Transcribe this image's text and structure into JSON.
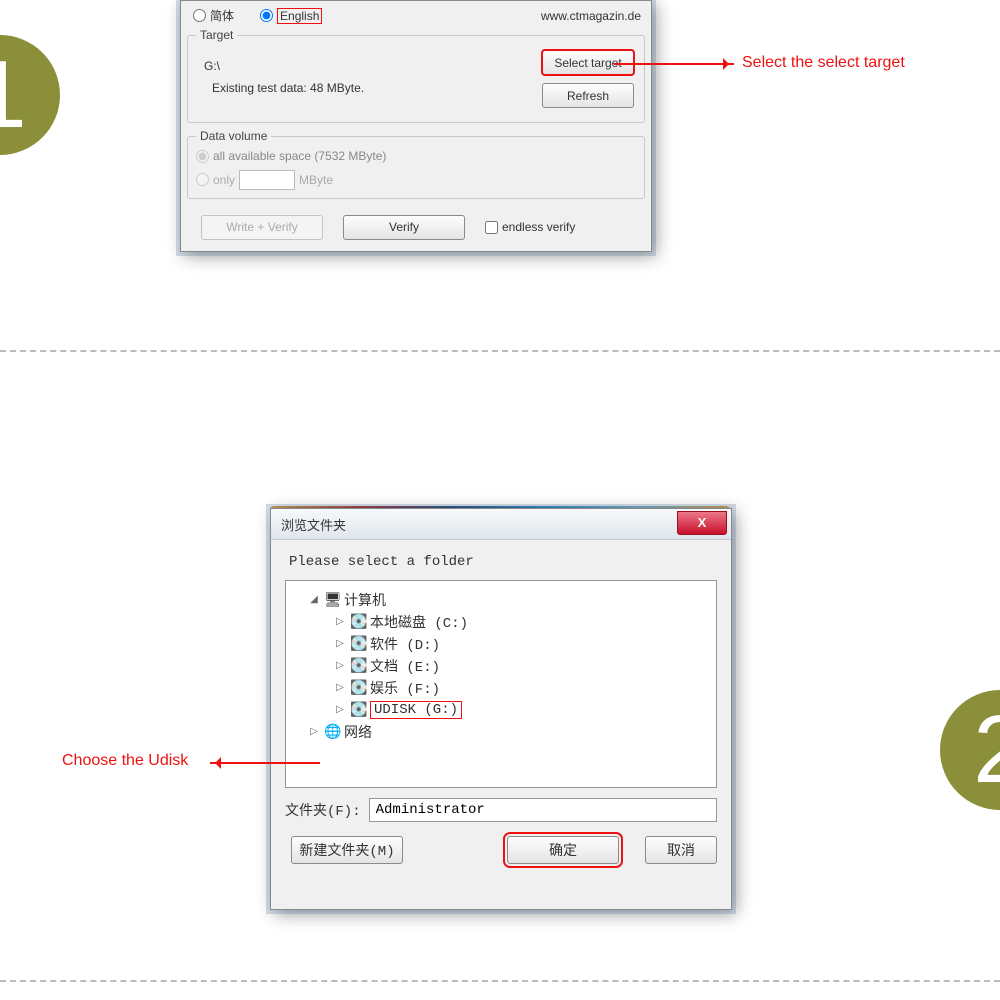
{
  "step1": {
    "badge": "1"
  },
  "step2": {
    "badge": "2"
  },
  "annot1": "Select the select target",
  "annot2": "Choose the Udisk",
  "dlg1": {
    "lang": {
      "cn": "简体",
      "en": "English"
    },
    "site": "www.ctmagazin.de",
    "target": {
      "legend": "Target",
      "drive": "G:\\",
      "existing": "Existing test data: 48 MByte.",
      "select_btn": "Select target",
      "refresh_btn": "Refresh"
    },
    "dv": {
      "legend": "Data volume",
      "opt_all": "all available space (7532 MByte)",
      "opt_only": "only",
      "unit": "MByte"
    },
    "footer": {
      "write_verify": "Write + Verify",
      "verify": "Verify",
      "endless": "endless verify"
    }
  },
  "dlg2": {
    "title": "浏览文件夹",
    "close": "X",
    "prompt": "Please select a folder",
    "tree": {
      "root": "计算机",
      "c": "本地磁盘 (C:)",
      "d": "软件 (D:)",
      "e": "文档 (E:)",
      "f": "娱乐 (F:)",
      "g": "UDISK (G:)",
      "net": "网络"
    },
    "folder_label": "文件夹(F):",
    "folder_value": "Administrator",
    "btn_new": "新建文件夹(M)",
    "btn_ok": "确定",
    "btn_cancel": "取消"
  }
}
